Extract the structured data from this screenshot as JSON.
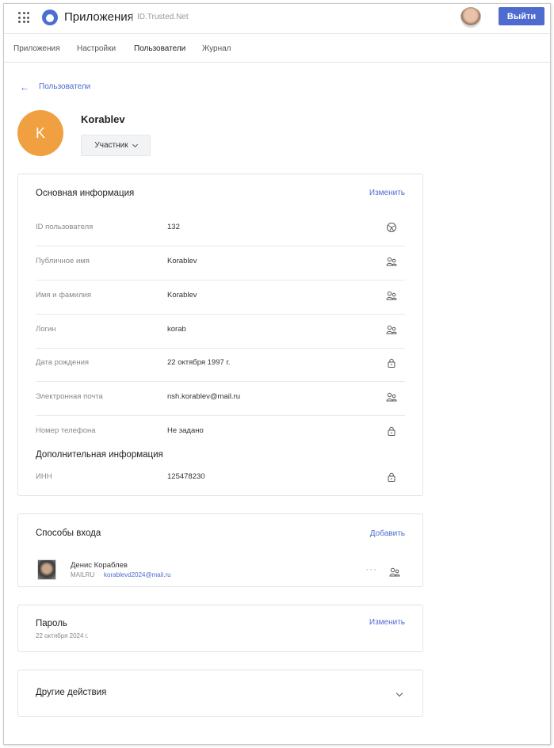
{
  "header": {
    "app_title": "Приложения",
    "app_subtitle": "ID.Trusted.Net",
    "logout_label": "Выйти"
  },
  "tabs": [
    {
      "label": "Приложения"
    },
    {
      "label": "Настройки"
    },
    {
      "label": "Пользователи",
      "active": true
    },
    {
      "label": "Журнал"
    }
  ],
  "breadcrumb": {
    "back_label": "Пользователи",
    "arrow": "←"
  },
  "profile": {
    "initial": "K",
    "name": "Korablev",
    "role": "Участник",
    "avatar_color": "#f0a040"
  },
  "main_info": {
    "title": "Основная информация",
    "edit_label": "Изменить",
    "rows": [
      {
        "label": "ID пользователя",
        "value": "132",
        "icon": "globe-icon"
      },
      {
        "label": "Публичное имя",
        "value": "Korablev",
        "icon": "users-icon"
      },
      {
        "label": "Имя и фамилия",
        "value": "Korablev",
        "icon": "users-icon"
      },
      {
        "label": "Логин",
        "value": "korab",
        "icon": "users-icon"
      },
      {
        "label": "Дата рождения",
        "value": "22 октября 1997 г.",
        "icon": "lock-icon"
      },
      {
        "label": "Электронная почта",
        "value": "nsh.korablev@mail.ru",
        "icon": "users-icon"
      },
      {
        "label": "Номер телефона",
        "value": "Не задано",
        "icon": "lock-icon"
      }
    ],
    "additional_title": "Дополнительная информация",
    "additional_rows": [
      {
        "label": "ИНН",
        "value": "125478230",
        "icon": "lock-icon"
      }
    ]
  },
  "login_methods": {
    "title": "Способы входа",
    "add_label": "Добавить",
    "items": [
      {
        "name": "Денис Кораблев",
        "provider": "MAILRU",
        "email": "korablevd2024@mail.ru"
      }
    ]
  },
  "password": {
    "title": "Пароль",
    "date": "22 октября 2024 г.",
    "edit_label": "Изменить"
  },
  "other_actions": {
    "title": "Другие действия"
  },
  "colors": {
    "accent": "#4e6bd0",
    "avatar": "#f0a040"
  }
}
